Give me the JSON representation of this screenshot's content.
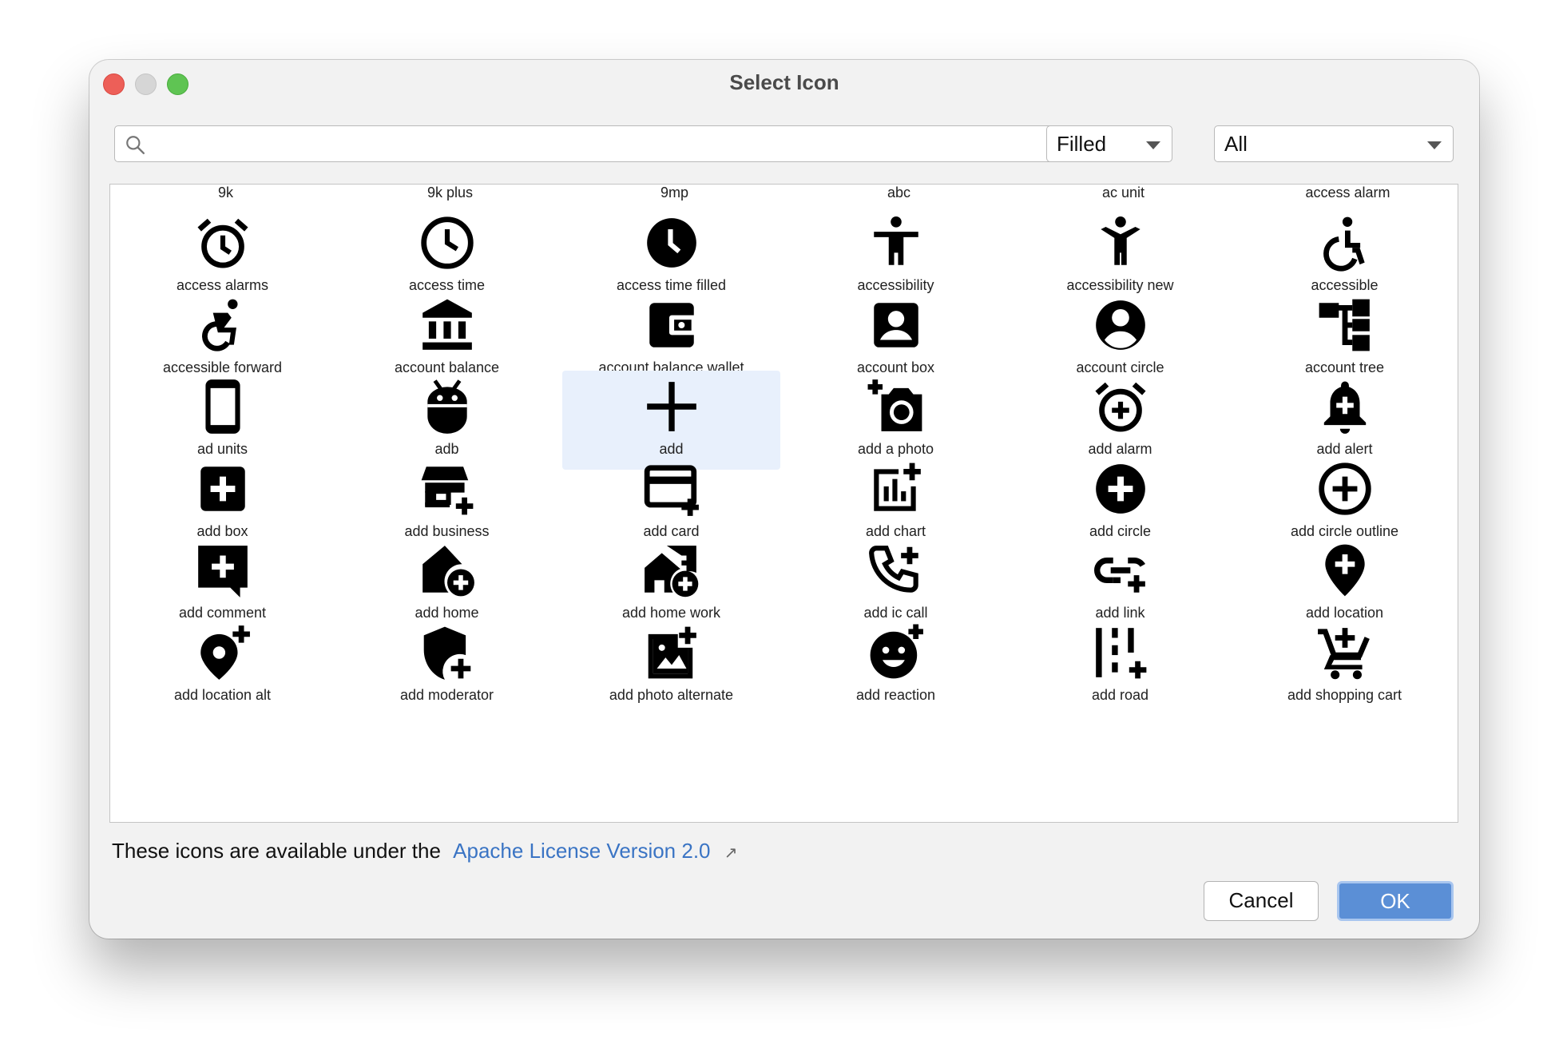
{
  "window": {
    "title": "Select Icon"
  },
  "search": {
    "value": "",
    "placeholder": ""
  },
  "filters": {
    "style": "Filled",
    "category": "All"
  },
  "grid": {
    "header_labels": [
      "9k",
      "9k plus",
      "9mp",
      "abc",
      "ac unit",
      "access alarm"
    ],
    "selected_label": "add",
    "icons": [
      {
        "label": "access alarms",
        "icon": "alarm"
      },
      {
        "label": "access time",
        "icon": "clock-outline"
      },
      {
        "label": "access time filled",
        "icon": "clock-filled"
      },
      {
        "label": "accessibility",
        "icon": "accessibility"
      },
      {
        "label": "accessibility new",
        "icon": "accessibility-new"
      },
      {
        "label": "accessible",
        "icon": "wheelchair"
      },
      {
        "label": "accessible forward",
        "icon": "wheelchair-forward"
      },
      {
        "label": "account balance",
        "icon": "bank"
      },
      {
        "label": "account balance wallet",
        "icon": "wallet"
      },
      {
        "label": "account box",
        "icon": "account-box"
      },
      {
        "label": "account circle",
        "icon": "account-circle"
      },
      {
        "label": "account tree",
        "icon": "tree"
      },
      {
        "label": "ad units",
        "icon": "phone"
      },
      {
        "label": "adb",
        "icon": "android"
      },
      {
        "label": "add",
        "icon": "plus"
      },
      {
        "label": "add a photo",
        "icon": "camera-plus"
      },
      {
        "label": "add alarm",
        "icon": "alarm-plus"
      },
      {
        "label": "add alert",
        "icon": "bell-plus"
      },
      {
        "label": "add box",
        "icon": "box-plus"
      },
      {
        "label": "add business",
        "icon": "store-plus"
      },
      {
        "label": "add card",
        "icon": "card-plus"
      },
      {
        "label": "add chart",
        "icon": "chart-plus"
      },
      {
        "label": "add circle",
        "icon": "circle-plus"
      },
      {
        "label": "add circle outline",
        "icon": "circle-plus-outline"
      },
      {
        "label": "add comment",
        "icon": "comment-plus"
      },
      {
        "label": "add home",
        "icon": "home-plus"
      },
      {
        "label": "add home work",
        "icon": "home-work-plus"
      },
      {
        "label": "add ic call",
        "icon": "call-plus"
      },
      {
        "label": "add link",
        "icon": "link-plus"
      },
      {
        "label": "add location",
        "icon": "location-plus"
      },
      {
        "label": "add location alt",
        "icon": "location-alt-plus"
      },
      {
        "label": "add moderator",
        "icon": "shield-plus"
      },
      {
        "label": "add photo alternate",
        "icon": "photo-plus"
      },
      {
        "label": "add reaction",
        "icon": "reaction-plus"
      },
      {
        "label": "add road",
        "icon": "road-plus"
      },
      {
        "label": "add shopping cart",
        "icon": "cart-plus"
      }
    ]
  },
  "footer": {
    "license_text": "These icons are available under the",
    "license_link": "Apache License Version 2.0",
    "external_glyph": "↗"
  },
  "buttons": {
    "cancel": "Cancel",
    "ok": "OK"
  },
  "colors": {
    "accent": "#5b8fd6",
    "link": "#3a74c4",
    "selection": "#e8f0fc"
  }
}
